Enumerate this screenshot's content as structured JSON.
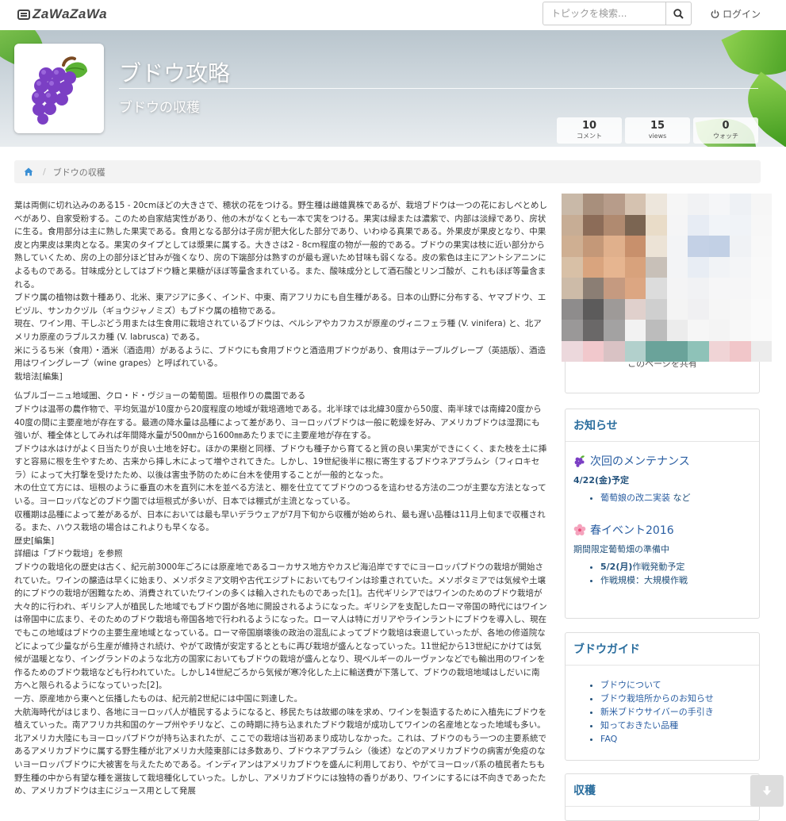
{
  "nav": {
    "logo": "ZaWaZaWa",
    "search_placeholder": "トピックを検索...",
    "login": "ログイン"
  },
  "hero": {
    "title": "ブドウ攻略",
    "subtitle": "ブドウの収穫",
    "stats": [
      {
        "value": "10",
        "label": "コメント"
      },
      {
        "value": "15",
        "label": "views"
      },
      {
        "value": "0",
        "label": "ウォッチ"
      }
    ]
  },
  "breadcrumb": {
    "current": "ブドウの収穫"
  },
  "article": {
    "paragraphs": [
      "葉は両側に切れ込みのある15 - 20cmほどの大きさで、穂状の花をつける。野生種は雌雄異株であるが、栽培ブドウは一つの花におしべとめしべがあり、自家受粉する。このため自家結実性があり、他の木がなくとも一本で実をつける。果実は緑または濃紫で、内部は淡緑であり、房状に生る。食用部分は主に熟した果実である。食用となる部分は子房が肥大化した部分であり、いわゆる真果である。外果皮が果皮となり、中果皮と内果皮は果肉となる。果実のタイプとしては漿果に属する。大きさは2 - 8cm程度の物が一般的である。ブドウの果実は枝に近い部分から熟していくため、房の上の部分ほど甘みが強くなり、房の下端部分は熟すのが最も遅いため甘味も弱くなる。皮の紫色は主にアントシアニンによるものである。甘味成分としてはブドウ糖と果糖がほぼ等量含まれている。また、酸味成分として酒石酸とリンゴ酸が、これもほぼ等量含まれる。",
      "ブドウ属の植物は数十種あり、北米、東アジアに多く、インド、中東、南アフリカにも自生種がある。日本の山野に分布する、ヤマブドウ、エビヅル、サンカクヅル（ギョウジャノミズ）もブドウ属の植物である。",
      "現在、ワイン用、干しぶどう用または生食用に栽培されているブドウは、ペルシアやカフカスが原産のヴィニフェラ種 (V. vinifera) と、北アメリカ原産のラブルスカ種 (V. labrusca) である。",
      "米にうるち米（食用）・酒米（酒造用）があるように、ブドウにも食用ブドウと酒造用ブドウがあり、食用はテーブルグレープ（英語版）、酒造用はワイングレープ（wine grapes）と呼ばれている。",
      "栽培法[編集]",
      "仏ブルゴーニュ地域圏、クロ・ド・ヴジョーの葡萄園。垣根作りの農園である",
      "ブドウは温帯の農作物で、平均気温が10度から20度程度の地域が栽培適地である。北半球では北緯30度から50度、南半球では南緯20度から40度の間に主要産地が存在する。最適の降水量は品種によって差があり、ヨーロッパブドウは一般に乾燥を好み、アメリカブドウは湿潤にも強いが、種全体としてみれば年間降水量が500㎜から1600㎜あたりまでに主要産地が存在する。",
      "ブドウは水はけがよく日当たりが良い土地を好む。ほかの果樹と同様、ブドウも種子から育てると質の良い果実ができにくく、また枝を土に挿すと容易に根を生やすため、古来から挿し木によって増やされてきた。しかし、19世紀後半に根に寄生するブドウネアブラムシ（フィロキセラ）によって大打撃を受けたため、以後は害虫予防のために台木を使用することが一般的となった。",
      "木の仕立て方には、垣根のように垂直の木を直列に木を並べる方法と、棚を仕立ててブドウのつるを這わせる方法の二つが主要な方法となっている。ヨーロッパなどのブドウ園では垣根式が多いが、日本では棚式が主流となっている。",
      "収穫期は品種によって差があるが、日本においては最も早いデラウェアが7月下旬から収穫が始められ、最も遅い品種は11月上旬まで収穫される。また、ハウス栽培の場合はこれよりも早くなる。",
      "歴史[編集]",
      "詳細は「ブドウ栽培」を参照",
      "ブドウの栽培化の歴史は古く、紀元前3000年ごろには原産地であるコーカサス地方やカスピ海沿岸ですでにヨーロッパブドウの栽培が開始されていた。ワインの醸造は早くに始まり、メソポタミア文明や古代エジプトにおいてもワインは珍重されていた。メソポタミアでは気候や土壌的にブドウの栽培が困難なため、消費されていたワインの多くは輸入されたものであった[1]。古代ギリシアではワインのためのブドウ栽培が大々的に行われ、ギリシア人が植民した地域でもブドウ園が各地に開設されるようになった。ギリシアを支配したローマ帝国の時代にはワインは帝国中に広まり、そのためのブドウ栽培も帝国各地で行われるようになった。ローマ人は特にガリアやラインラントにブドウを導入し、現在でもこの地域はブドウの主要生産地域となっている。ローマ帝国崩壊後の政治の混乱によってブドウ栽培は衰退していったが、各地の修道院などによって少量ながら生産が維持され続け、やがて政情が安定するとともに再び栽培が盛んとなっていった。11世紀から13世紀にかけては気候が温暖となり、イングランドのような北方の国家においてもブドウの栽培が盛んとなり、現ベルギーのルーヴァンなどでも輸出用のワインを作るためのブドウ栽培なども行われていた。しかし14世紀ごろから気候が寒冷化した上に輸送費が下落して、ブドウの栽培地域はしだいに南方へと限られるようになっていった[2]。",
      "一方、原産地から東へと伝播したものは、紀元前2世紀には中国に到達した。",
      "大航海時代がはじまり、各地にヨーロッパ人が植民するようになると、移民たちは故郷の味を求め、ワインを製造するために入植先にブドウを植えていった。南アフリカ共和国のケープ州やチリなど、この時期に持ち込まれたブドウ栽培が成功してワインの名産地となった地域も多い。北アメリカ大陸にもヨーロッパブドウが持ち込まれたが、ここでの栽培は当初あまり成功しなかった。これは、ブドウのもう一つの主要系統であるアメリカブドウに属する野生種が北アメリカ大陸東部には多数あり、ブドウネアブラムシ（後述）などのアメリカブドウの病害が免疫のないヨーロッパブドウに大被害を与えたためである。インディアンはアメリカブドウを盛んに利用しており、やがてヨーロッパ系の植民者たちも野生種の中から有望な種を選抜して栽培種化していった。しかし、アメリカブドウには独特の香りがあり、ワインにするには不向きであったため、アメリカブドウは主にジュース用として発展"
    ]
  },
  "sidebar": {
    "share_label": "このページを共有",
    "notice": {
      "title": "お知らせ",
      "events": [
        {
          "title": "次回のメンテナンス",
          "date": "4/22(金)予定",
          "items": [
            {
              "link": "葡萄娘の改二実装",
              "suffix": " など"
            }
          ]
        },
        {
          "title": "春イベント2016",
          "date": "期間限定葡萄畑の準備中",
          "items": [
            {
              "bold": "5/2(月)",
              "text": "作戦発動予定"
            },
            {
              "text": "作戦規模：大規模作戦"
            }
          ]
        }
      ]
    },
    "guide": {
      "title": "ブドウガイド",
      "links": [
        "ブドウについて",
        "ブドウ栽培所からのお知らせ",
        "新米ブドウサイバーの手引き",
        "知っておきたい品種",
        "FAQ"
      ]
    },
    "harvest": {
      "title": "収穫"
    }
  },
  "colors": {
    "accent": "#2b6e9e",
    "link": "#2a5ea2",
    "pixel_palette": [
      [
        "#c9b9a8",
        "#a88f7c",
        "#b79c8a",
        "#d5c2b0",
        "#ede6dc",
        "#f6f6f6",
        "#f1f2f4",
        "#f5f6f8",
        "#eef1f5",
        "#f6f6f6"
      ],
      [
        "#c7ad95",
        "#8c6c58",
        "#b08a70",
        "#7b6552",
        "#e9dcc8",
        "#f5f5f6",
        "#e7ecf4",
        "#f1f4f8",
        "#f0f3f7",
        "#f7f7f7"
      ],
      [
        "#cfaf92",
        "#c49878",
        "#e0b08c",
        "#c8906c",
        "#ece3d6",
        "#f3f4f6",
        "#c4d1e6",
        "#c2d0e5",
        "#f0f2f5",
        "#f8f8f8"
      ],
      [
        "#d8c0a6",
        "#d9a47e",
        "#e6b590",
        "#d8a27c",
        "#c8c0b8",
        "#f3f4f6",
        "#e8edf4",
        "#f1f3f6",
        "#f4f5f7",
        "#f9f9f9"
      ],
      [
        "#cdbba8",
        "#8b7e74",
        "#c59a80",
        "#dca682",
        "#dcdcdc",
        "#f4f4f5",
        "#f1f2f4",
        "#f6f6f7",
        "#f6f6f7",
        "#f9f9f9"
      ],
      [
        "#8e8c8c",
        "#5c5b5b",
        "#9e9a98",
        "#e0d0cc",
        "#cfcfcf",
        "#f4f4f4",
        "#f0f0f2",
        "#f6f6f6",
        "#f7f7f7",
        "#fafafa"
      ],
      [
        "#9a9898",
        "#6a6868",
        "#a3a2a2",
        "#f2f2f2",
        "#bcbcbc",
        "#ececec",
        "#f6f6f6",
        "#f4f4f4",
        "#f8f8f8",
        "#fafafa"
      ],
      [
        "#ecd8dc",
        "#f1c8cc",
        "#d9c2c4",
        "#b2d0cc",
        "#6aa39a",
        "#6aa39a",
        "#8ec2b8",
        "#f0d4d6",
        "#f1c6c9",
        "#ececec"
      ]
    ]
  }
}
